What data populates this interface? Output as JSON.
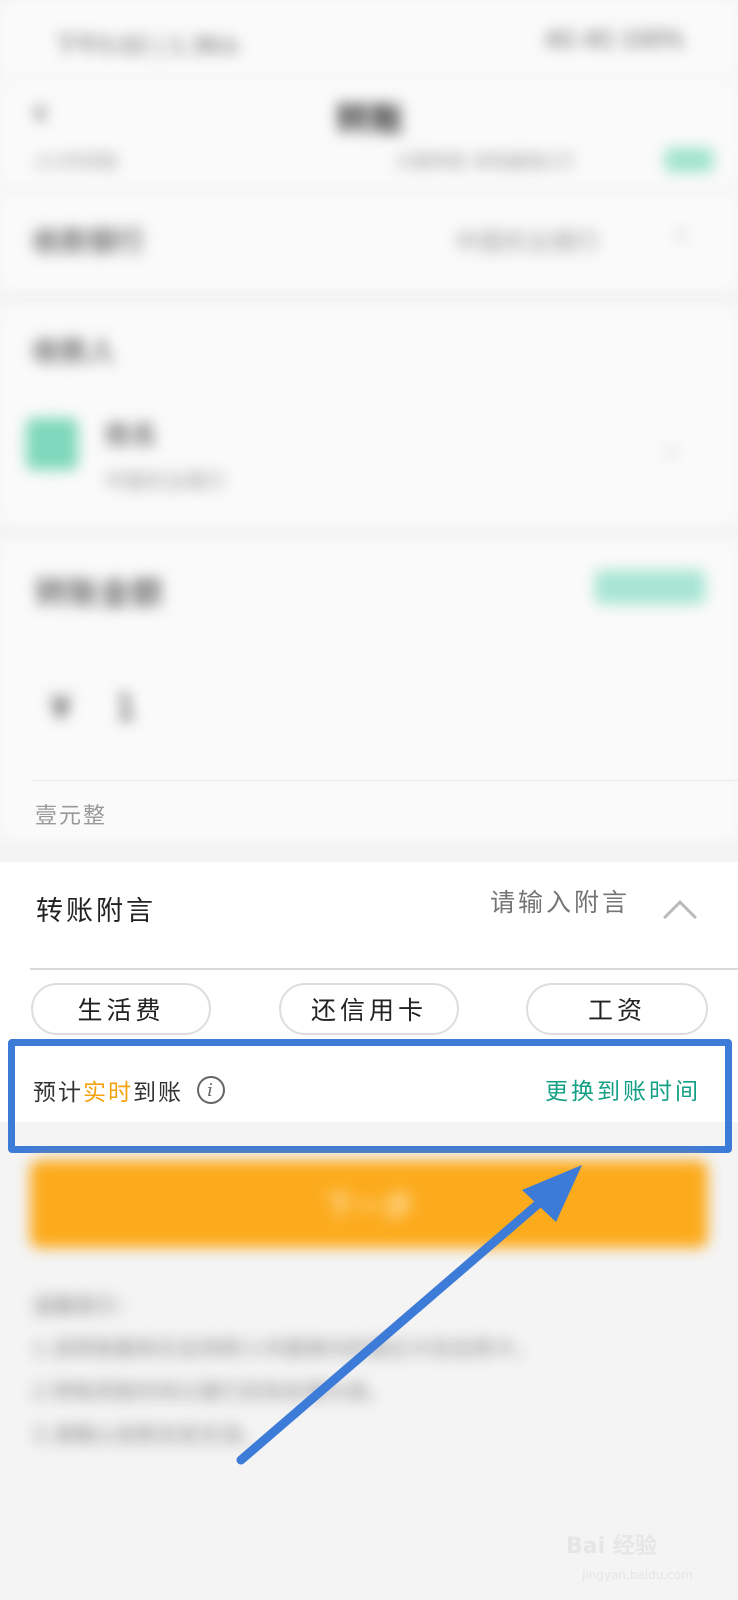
{
  "status_bar": {
    "left": "下午5:02 | 1.3K/s",
    "right": "4G 4G 100%"
  },
  "header": {
    "title": "转账",
    "sub_left": "2小时到账",
    "sub_right": "大额转账 单笔最高5万"
  },
  "bank_row": {
    "label": "收款银行",
    "value": "中国农业银行"
  },
  "payee": {
    "label": "收款人",
    "name": "姓名",
    "sub": "中国农业银行"
  },
  "amount": {
    "label": "转账金额",
    "symbol": "¥",
    "value": "1",
    "words": "壹元整"
  },
  "remark": {
    "label": "转账附言",
    "placeholder": "请输入附言",
    "chips": [
      "生活费",
      "还信用卡",
      "工资"
    ]
  },
  "arrival": {
    "prefix": "预计",
    "highlight": "实时",
    "suffix": "到账",
    "info_icon": "i",
    "change_link": "更换到账时间"
  },
  "next_button": "下一步",
  "notes": [
    "温馨提示：",
    "1.该转账服务仅支持转入中国境内的借记卡及信用卡，",
    "2.转账到账时间以银行实际处理为准。",
    "3.请确认收款信息无误。"
  ],
  "watermark": {
    "text": "Bai 经验",
    "sub": "jingyan.baidu.com"
  },
  "colors": {
    "accent_orange": "#fcab1d",
    "highlight_blue": "#3d7bd8",
    "link_green": "#14a085",
    "realtime_orange": "#f5a20f"
  }
}
